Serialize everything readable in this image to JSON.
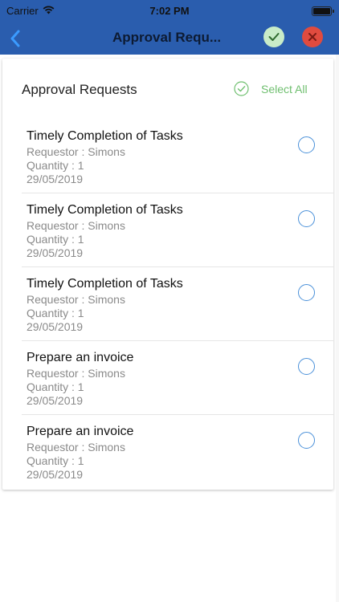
{
  "status_bar": {
    "carrier": "Carrier",
    "time": "7:02 PM",
    "icons": [
      "wifi-icon",
      "battery-icon"
    ]
  },
  "nav_bar": {
    "back_icon": "chevron-left-icon",
    "title": "Approval Requ...",
    "approve_icon": "check-circle-icon",
    "reject_icon": "close-circle-icon",
    "colors": {
      "background": "#2a5dae",
      "approve": "#c8ecc8",
      "reject": "#e04b3f"
    }
  },
  "card": {
    "title": "Approval Requests",
    "select_all_label": "Select All",
    "select_all_icon": "check-circle-outline-icon"
  },
  "requests": [
    {
      "title": "Timely Completion of Tasks",
      "requestor": "Requestor : Simons",
      "quantity": "Quantity : 1",
      "date": "29/05/2019",
      "selected": false
    },
    {
      "title": "Timely Completion of Tasks",
      "requestor": "Requestor : Simons",
      "quantity": "Quantity : 1",
      "date": "29/05/2019",
      "selected": false
    },
    {
      "title": "Timely Completion of Tasks",
      "requestor": "Requestor : Simons",
      "quantity": "Quantity : 1",
      "date": "29/05/2019",
      "selected": false
    },
    {
      "title": "Prepare an invoice",
      "requestor": "Requestor : Simons",
      "quantity": "Quantity : 1",
      "date": "29/05/2019",
      "selected": false
    },
    {
      "title": "Prepare an invoice",
      "requestor": "Requestor : Simons",
      "quantity": "Quantity : 1",
      "date": "29/05/2019",
      "selected": false
    }
  ]
}
